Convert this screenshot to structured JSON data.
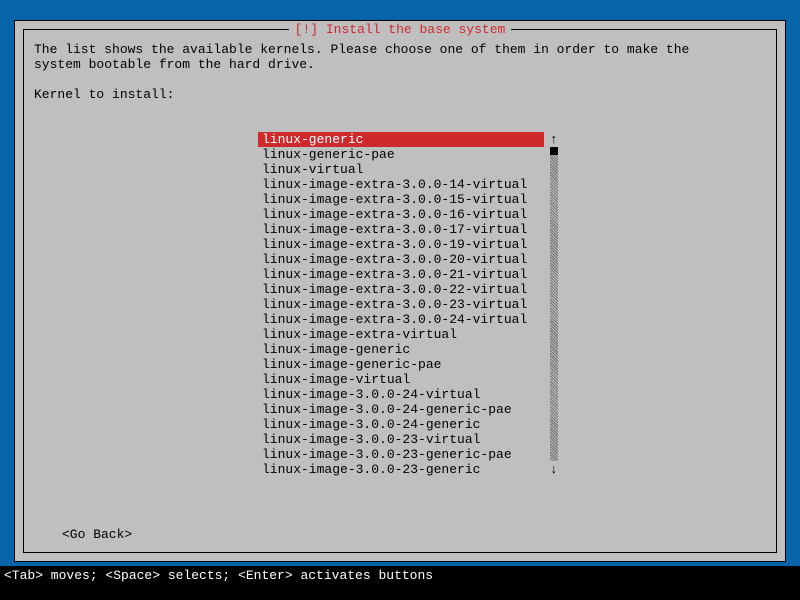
{
  "dialog": {
    "title": "[!] Install the base system",
    "description": "The list shows the available kernels. Please choose one of them in order to make the\nsystem bootable from the hard drive.",
    "prompt": "Kernel to install:",
    "goBack": "<Go Back>"
  },
  "kernels": [
    "linux-generic",
    "linux-generic-pae",
    "linux-virtual",
    "linux-image-extra-3.0.0-14-virtual",
    "linux-image-extra-3.0.0-15-virtual",
    "linux-image-extra-3.0.0-16-virtual",
    "linux-image-extra-3.0.0-17-virtual",
    "linux-image-extra-3.0.0-19-virtual",
    "linux-image-extra-3.0.0-20-virtual",
    "linux-image-extra-3.0.0-21-virtual",
    "linux-image-extra-3.0.0-22-virtual",
    "linux-image-extra-3.0.0-23-virtual",
    "linux-image-extra-3.0.0-24-virtual",
    "linux-image-extra-virtual",
    "linux-image-generic",
    "linux-image-generic-pae",
    "linux-image-virtual",
    "linux-image-3.0.0-24-virtual",
    "linux-image-3.0.0-24-generic-pae",
    "linux-image-3.0.0-24-generic",
    "linux-image-3.0.0-23-virtual",
    "linux-image-3.0.0-23-generic-pae",
    "linux-image-3.0.0-23-generic"
  ],
  "selectedIndex": 0,
  "scrollIndicators": {
    "up": "↑",
    "down": "↓"
  },
  "statusBar": "<Tab> moves; <Space> selects; <Enter> activates buttons"
}
